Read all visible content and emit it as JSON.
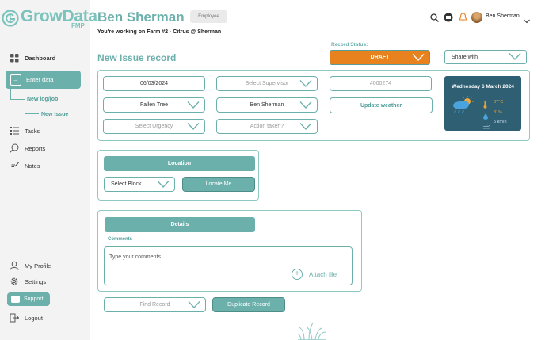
{
  "brand": {
    "name": "GrowData",
    "sub": "FMP",
    "color": "#7cc3bd"
  },
  "sidebar": {
    "dashboard": "Dashboard",
    "enter_data": "Enter data",
    "new_log": "New log/job",
    "new_issue": "New Issue",
    "tasks": "Tasks",
    "reports": "Reports",
    "notes": "Notes",
    "my_profile": "My Profile",
    "settings": "Settings",
    "support": "Support",
    "logout": "Logout"
  },
  "header": {
    "user_title": "Ben Sherman",
    "role": "Employee",
    "working_on": "You're working on Farm #2 - Citrus @ Sherman",
    "user_menu": "Ben Sherman"
  },
  "page": {
    "title": "New Issue record",
    "record_status_label": "Record Status:",
    "record_status": "DRAFT",
    "share_with": "Share with"
  },
  "form": {
    "date": "06/03/2024",
    "supervisor_placeholder": "Select Supervisor",
    "record_id": "#000274",
    "issue_type": "Fallen Tree",
    "assignee": "Ben Sherman",
    "update_weather": "Update weather",
    "urgency_placeholder": "Select Urgency",
    "action_placeholder": "Action taken?"
  },
  "weather": {
    "date": "Wednesday 6 March 2024",
    "temperature": "37°C",
    "humidity": "81%",
    "wind": "5 km/h"
  },
  "location": {
    "header": "Location",
    "block": "Select Block",
    "locate": "Locate Me"
  },
  "details": {
    "header": "Details",
    "comments_label": "Comments",
    "comments_placeholder": "Type your comments...",
    "attach": "Attach file"
  },
  "footer": {
    "find_record": "Find Record",
    "duplicate": "Duplicate Record"
  },
  "colors": {
    "teal": "#6cb0ac",
    "orange": "#e8821f",
    "weather_bg": "#2e5f73"
  }
}
